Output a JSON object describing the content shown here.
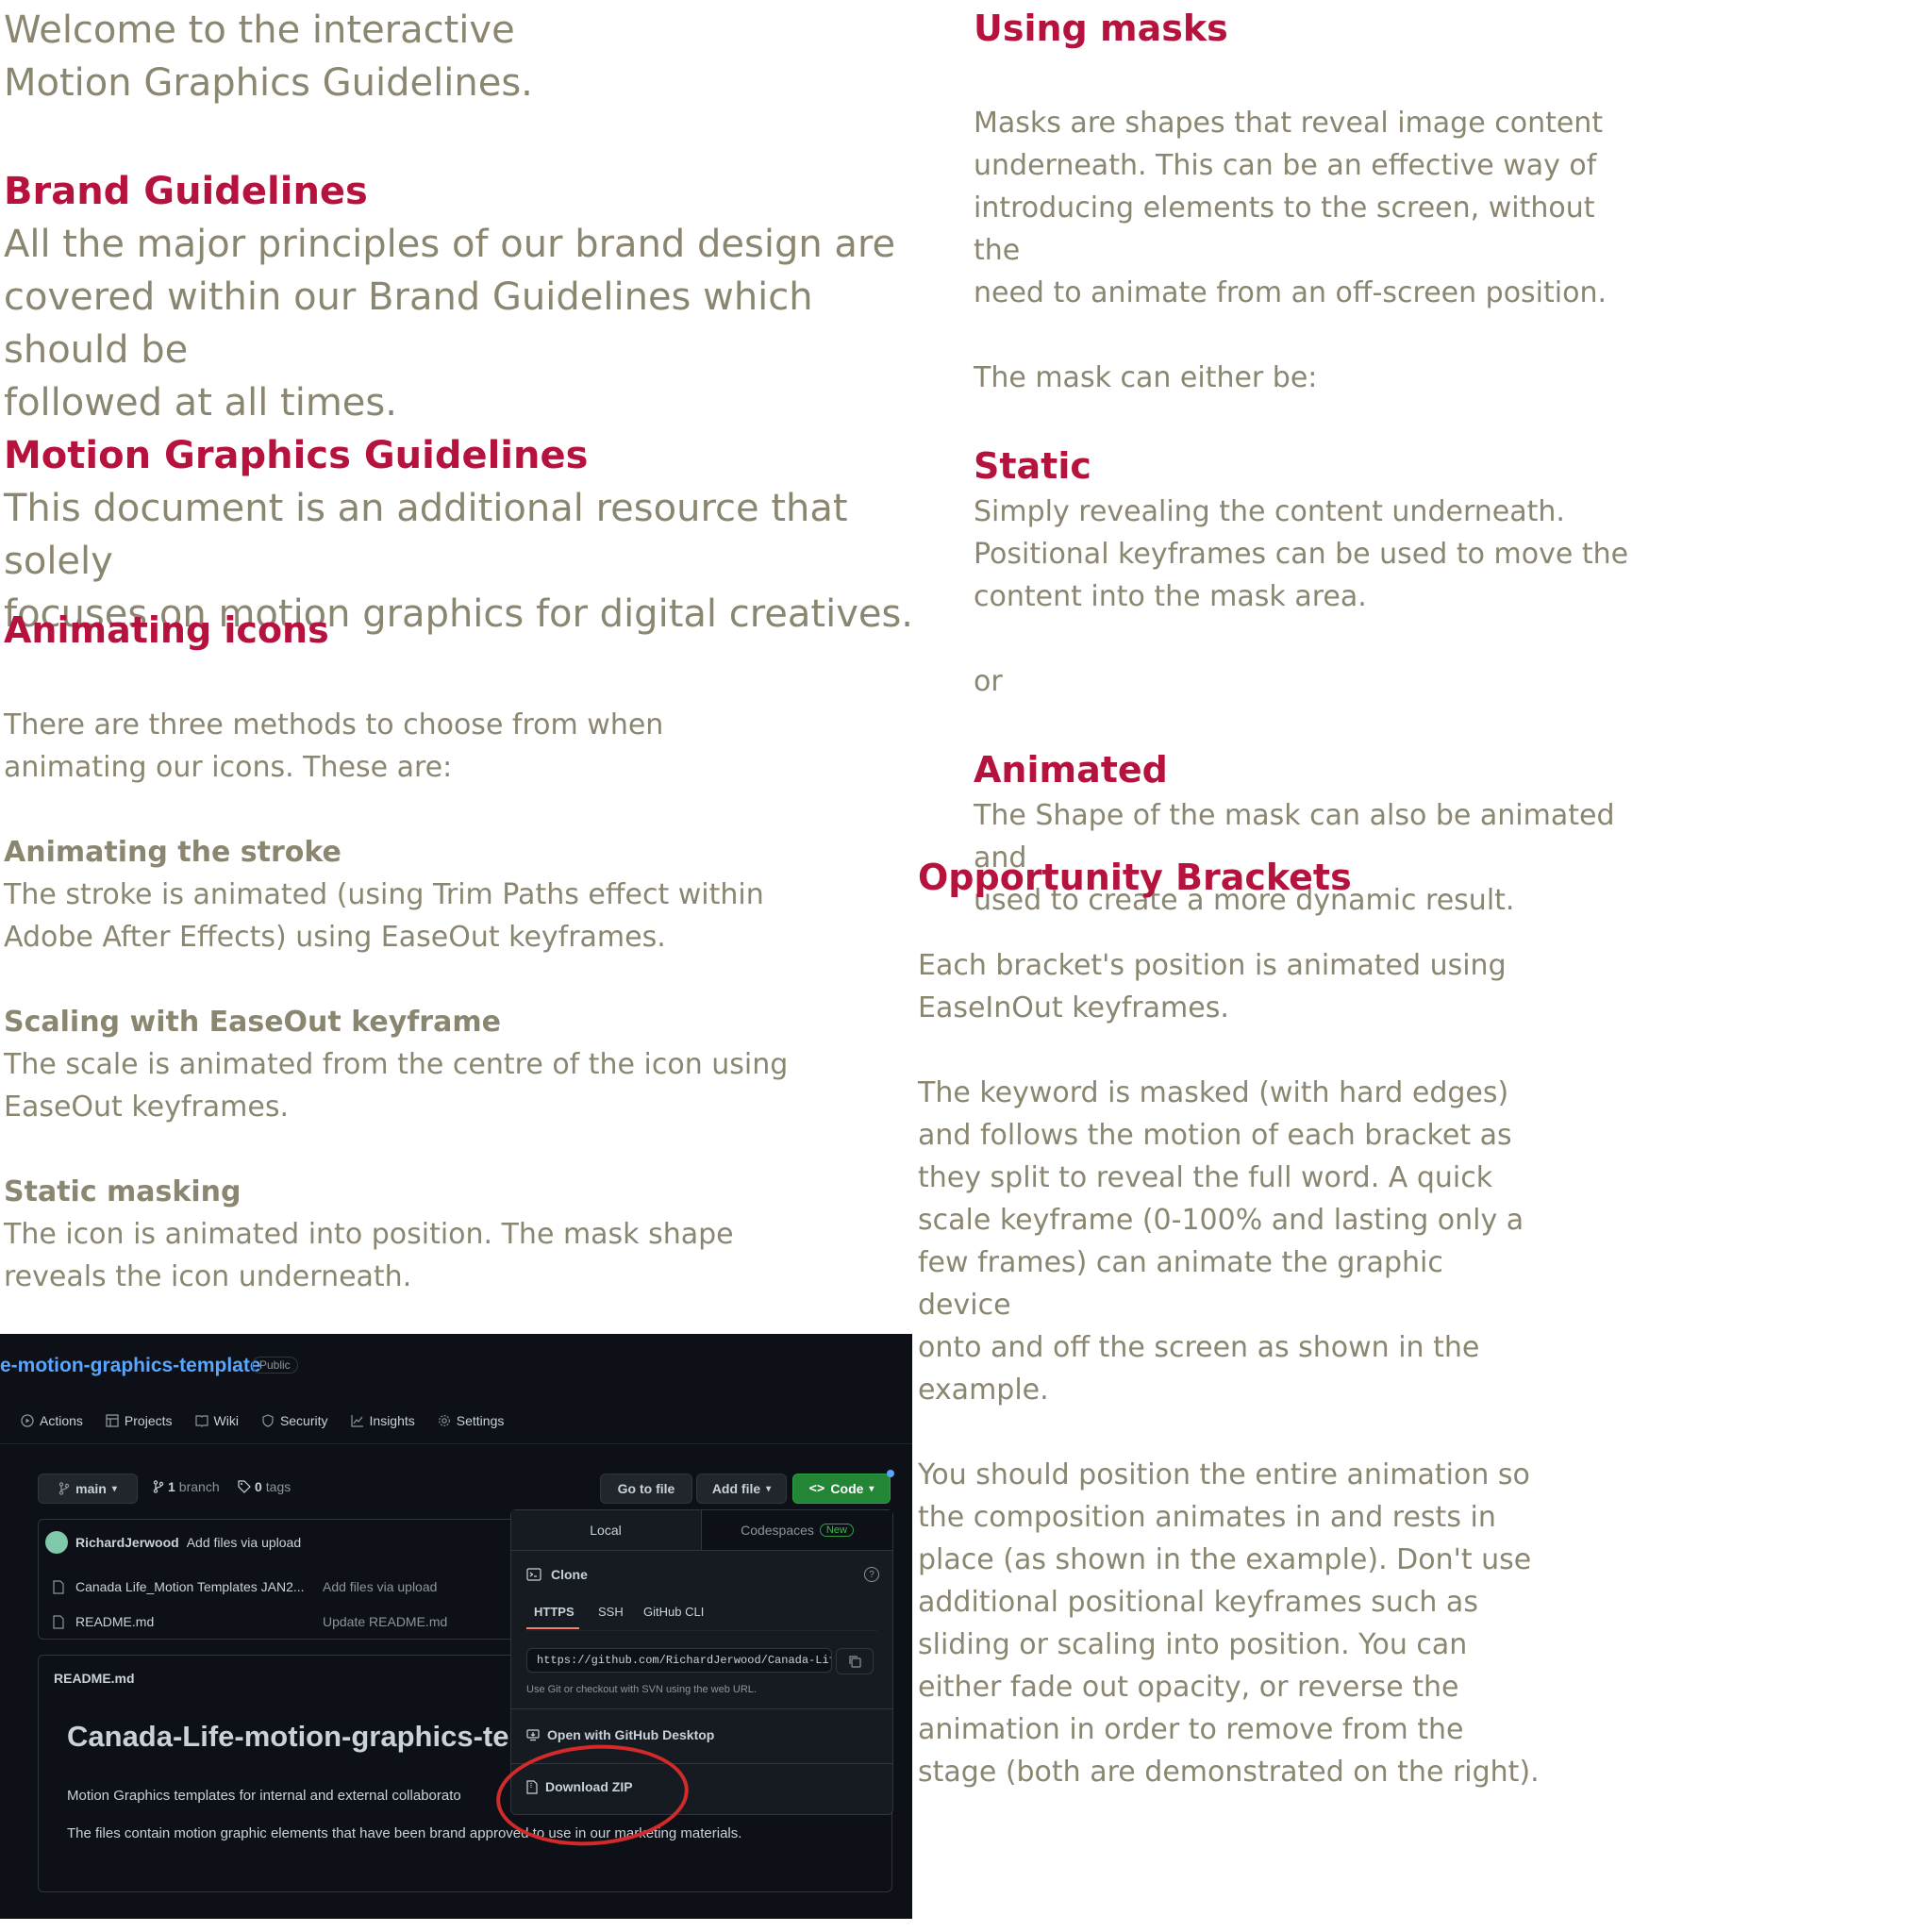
{
  "document": {
    "intro": [
      "Welcome to the interactive",
      "Motion Graphics Guidelines."
    ],
    "brand": {
      "heading": "Brand Guidelines",
      "lines": [
        "All the major principles of our brand design are",
        "covered within our Brand Guidelines  which should be",
        "followed at all times."
      ]
    },
    "motion": {
      "heading": "Motion Graphics Guidelines",
      "lines": [
        "This document is an additional resource that solely",
        "focuses on motion graphics for digital creatives."
      ]
    },
    "animating_icons": {
      "heading": "Animating icons",
      "intro": [
        "There are three methods to choose from when",
        "animating our icons. These are:"
      ],
      "stroke": {
        "title": "Animating the stroke",
        "lines": [
          "The stroke is animated (using Trim Paths effect within",
          "Adobe After Effects) using EaseOut keyframes."
        ]
      },
      "scaling": {
        "title": "Scaling with EaseOut keyframe",
        "lines": [
          "The scale is animated from the centre of the icon using",
          "EaseOut keyframes."
        ]
      },
      "static_masking": {
        "title": "Static masking",
        "lines": [
          "The icon is animated into position. The mask shape",
          "reveals the icon underneath."
        ]
      }
    },
    "masks": {
      "heading": "Using masks",
      "lines": [
        "Masks are shapes that reveal image content",
        "underneath. This can be an effective way of",
        "introducing elements to the screen, without the",
        "need to animate from an off-screen position."
      ],
      "either": "The mask can either be:",
      "static": {
        "heading": "Static",
        "lines": [
          "Simply revealing the content underneath.",
          "Positional keyframes can be used to move the",
          "content into the mask area."
        ]
      },
      "or": "or",
      "animated": {
        "heading": "Animated",
        "lines": [
          "The Shape of the mask can also be animated and",
          "used to create a more dynamic result."
        ]
      }
    },
    "brackets": {
      "heading": "Opportunity Brackets",
      "p1": [
        "Each bracket's position is animated using",
        "EaseInOut keyframes."
      ],
      "p2": [
        "The keyword is masked (with hard edges)",
        "and follows the motion of each bracket as",
        "they split to reveal the full word. A quick",
        "scale keyframe (0-100% and lasting only a",
        "few frames) can animate the graphic device",
        "onto and off the screen as shown in the",
        "example."
      ],
      "p3": [
        "You should position the entire animation so",
        "the composition animates in and rests in",
        "place (as shown in the example). Don't use",
        "additional positional keyframes such as",
        "sliding or scaling into position. You can",
        "either fade out opacity, or reverse the",
        "animation in order to remove from the",
        "stage (both are demonstrated on the right)."
      ]
    }
  },
  "github": {
    "repo_name": "e-motion-graphics-template",
    "visibility": "Public",
    "tabs": [
      {
        "label": "Actions",
        "icon": "play-icon"
      },
      {
        "label": "Projects",
        "icon": "table-icon"
      },
      {
        "label": "Wiki",
        "icon": "book-icon"
      },
      {
        "label": "Security",
        "icon": "shield-icon"
      },
      {
        "label": "Insights",
        "icon": "graph-icon"
      },
      {
        "label": "Settings",
        "icon": "gear-icon"
      }
    ],
    "branch": "main",
    "branch_count": "1",
    "branch_label": "branch",
    "tag_count": "0",
    "tag_label": "tags",
    "go_to_file": "Go to file",
    "add_file": "Add file",
    "code": "Code",
    "commit_author": "RichardJerwood",
    "commit_message": "Add files via upload",
    "files": [
      {
        "name": "Canada Life_Motion Templates JAN2...",
        "message": "Add files via upload"
      },
      {
        "name": "README.md",
        "message": "Update README.md"
      }
    ],
    "readme_label": "README.md",
    "readme_title": "Canada-Life-motion-graphics-te",
    "readme_desc": "Motion Graphics templates for internal and external collaborato",
    "readme_desc2": "The files contain motion graphic elements that have been brand approved to use in our marketing materials.",
    "popup": {
      "tab_local": "Local",
      "tab_codespaces": "Codespaces",
      "new_badge": "New",
      "clone": "Clone",
      "protocols": [
        "HTTPS",
        "SSH",
        "GitHub CLI"
      ],
      "url": "https://github.com/RichardJerwood/Canada-Life",
      "hint": "Use Git or checkout with SVN using the web URL.",
      "open_desktop": "Open with GitHub Desktop",
      "download_zip": "Download ZIP"
    },
    "colors": {
      "accent_link": "#58a6ff",
      "code_green": "#238636",
      "annotation_red": "#d42a2a"
    }
  }
}
